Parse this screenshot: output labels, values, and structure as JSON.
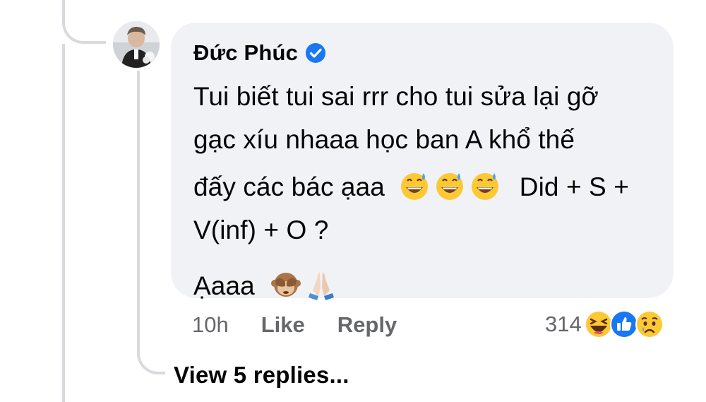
{
  "comment": {
    "author": "Đức Phúc",
    "verified": true,
    "avatar_icon": "profile-photo",
    "text_lines": [
      "Tui biết tui sai rrr cho tui sửa lại gỡ",
      "gạc xíu nhaaa học ban A khổ thế",
      "đấy các bác ạaa",
      "Did + S +",
      "V(inf) + O ?",
      "Ạaaa"
    ],
    "inline_emojis_line3": [
      "grinning-sweat-emoji",
      "grinning-sweat-emoji",
      "grinning-sweat-emoji"
    ],
    "inline_emojis_last": [
      "see-no-evil-monkey-emoji",
      "folded-hands-emoji"
    ]
  },
  "actions": {
    "time": "10h",
    "like_label": "Like",
    "reply_label": "Reply"
  },
  "reactions": {
    "count": "314",
    "icons": [
      "haha-reaction-icon",
      "like-reaction-icon",
      "sad-reaction-icon"
    ]
  },
  "view_replies_label": "View 5 replies...",
  "colors": {
    "bubble_bg": "#f0f2f5",
    "secondary_text": "#65676b",
    "verified_blue": "#1877f2",
    "thread_line": "#d8dadf"
  }
}
